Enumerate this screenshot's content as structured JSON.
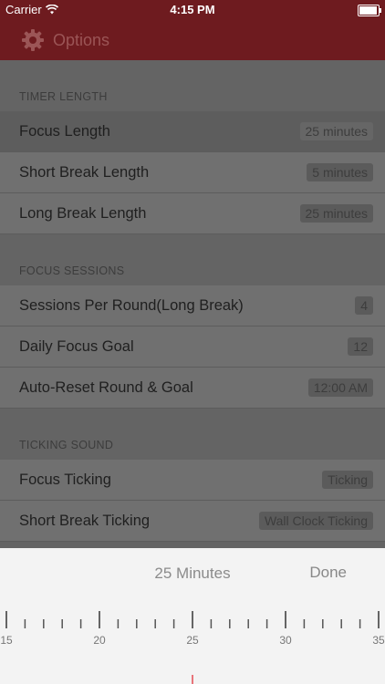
{
  "status": {
    "carrier": "Carrier",
    "time": "4:15 PM",
    "battery_percent": 100
  },
  "nav": {
    "title": "Options"
  },
  "sections": [
    {
      "header": "TIMER LENGTH",
      "rows": [
        {
          "label": "Focus Length",
          "value": "25 minutes"
        },
        {
          "label": "Short Break Length",
          "value": "5 minutes"
        },
        {
          "label": "Long Break Length",
          "value": "25 minutes"
        }
      ]
    },
    {
      "header": "FOCUS SESSIONS",
      "rows": [
        {
          "label": "Sessions Per Round(Long Break)",
          "value": "4"
        },
        {
          "label": "Daily Focus Goal",
          "value": "12"
        },
        {
          "label": "Auto-Reset Round & Goal",
          "value": "12:00 AM"
        }
      ]
    },
    {
      "header": "TICKING SOUND",
      "rows": [
        {
          "label": "Focus Ticking",
          "value": "Ticking"
        },
        {
          "label": "Short Break Ticking",
          "value": "Wall Clock Ticking"
        }
      ]
    }
  ],
  "picker": {
    "title": "25 Minutes",
    "done_label": "Done",
    "ruler": {
      "min": 15,
      "max": 35,
      "selected": 25,
      "labels": [
        "15",
        "20",
        "25",
        "30",
        "35"
      ]
    },
    "indicator_color": "#e8747a"
  },
  "colors": {
    "brand": "#6e1b1f"
  }
}
